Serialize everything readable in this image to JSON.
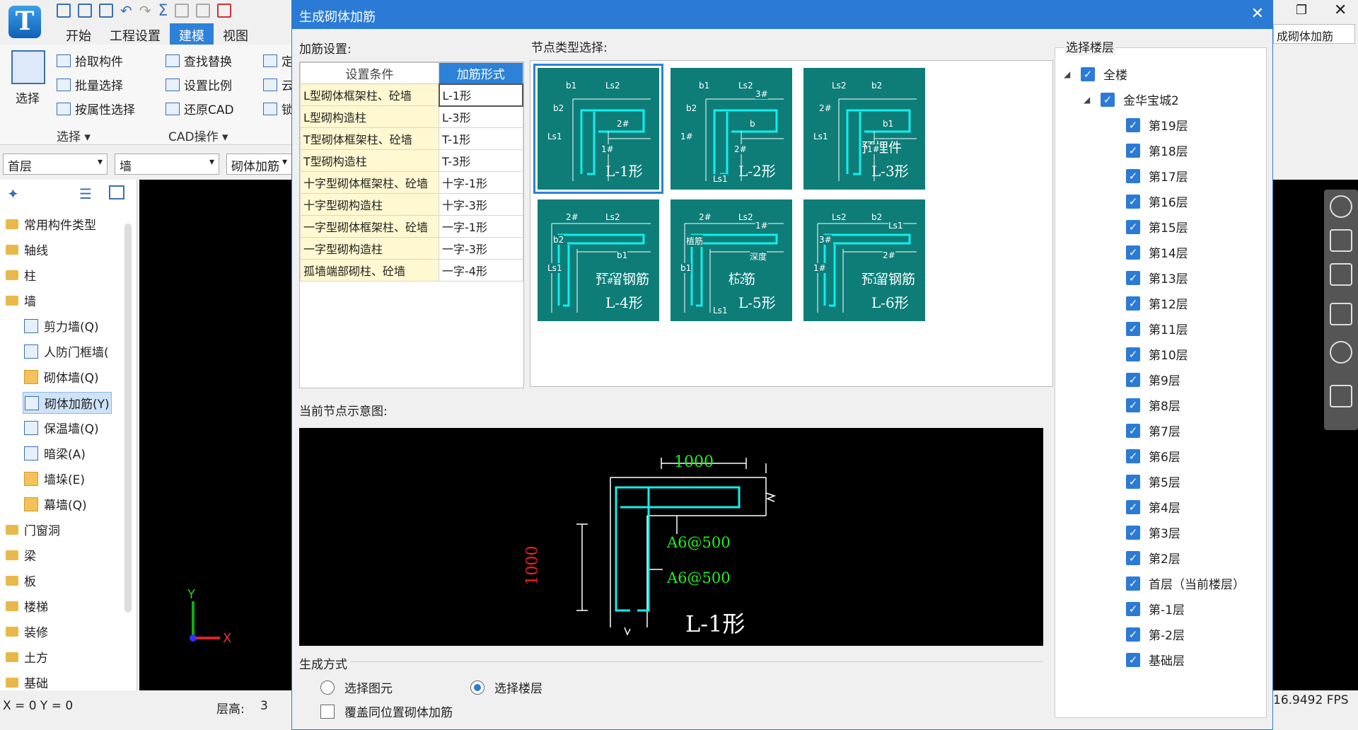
{
  "app": {
    "logo": "T"
  },
  "ribbon": {
    "tabs": [
      "开始",
      "工程设置",
      "建模",
      "视图"
    ],
    "active_tab": "建模",
    "select_label": "选择",
    "pick": "拾取构件",
    "batch": "批量选择",
    "by_attr": "按属性选择",
    "find_replace": "查找替换",
    "set_scale": "设置比例",
    "restore_cad": "还原CAD",
    "group_select": "选择",
    "group_cad": "CAD操作",
    "partial1": "定",
    "partial2": "云",
    "partial3": "锁"
  },
  "selectors": {
    "floor": "首层",
    "type": "墙",
    "component": "砌体加筋"
  },
  "tree": {
    "items": [
      "常用构件类型",
      "轴线",
      "柱",
      "墙"
    ],
    "wall_children": [
      "剪力墙(Q)",
      "人防门框墙(",
      "砌体墙(Q)",
      "砌体加筋(Y)",
      "保温墙(Q)",
      "暗梁(A)",
      "墙垛(E)",
      "幕墙(Q)"
    ],
    "items2": [
      "门窗洞",
      "梁",
      "板",
      "楼梯",
      "装修",
      "土方",
      "基础"
    ]
  },
  "canvas": {
    "axis_x": "X",
    "axis_y": "Y"
  },
  "status": {
    "coords": "X = 0 Y = 0",
    "floor_height_label": "层高:",
    "floor_height_value": "3",
    "fps": "16.9492 FPS"
  },
  "right": {
    "search_text": "成砌体加筋"
  },
  "dialog": {
    "title": "生成砌体加筋",
    "rebar_settings_label": "加筋设置:",
    "node_type_label": "节点类型选择:",
    "floor_select_label": "选择楼层",
    "current_node_label": "当前节点示意图:",
    "gen_method_label": "生成方式",
    "radio_select_element": "选择图元",
    "radio_select_floor": "选择楼层",
    "overwrite_label": "覆盖同位置砌体加筋",
    "table": {
      "headers": [
        "设置条件",
        "加筋形式"
      ],
      "rows": [
        [
          "L型砌体框架柱、砼墙",
          "L-1形"
        ],
        [
          "L型砌构造柱",
          "L-3形"
        ],
        [
          "T型砌体框架柱、砼墙",
          "T-1形"
        ],
        [
          "T型砌构造柱",
          "T-3形"
        ],
        [
          "十字型砌体框架柱、砼墙",
          "十字-1形"
        ],
        [
          "十字型砌构造柱",
          "十字-3形"
        ],
        [
          "一字型砌体框架柱、砼墙",
          "一字-1形"
        ],
        [
          "一字型砌构造柱",
          "一字-3形"
        ],
        [
          "孤墙端部砌柱、砼墙",
          "一字-4形"
        ]
      ]
    },
    "nodes": [
      {
        "name": "L-1形",
        "labels": [
          "b1",
          "Ls2",
          "b2",
          "2#",
          "1#",
          "Ls1"
        ]
      },
      {
        "name": "L-2形",
        "labels": [
          "b1",
          "Ls2",
          "b2",
          "b",
          "2#",
          "1#",
          "3#",
          "Ls1"
        ]
      },
      {
        "name": "L-3形",
        "extra": "预埋件",
        "labels": [
          "Ls2",
          "b2",
          "2#",
          "b1",
          "1#",
          "Ls1"
        ]
      },
      {
        "name": "L-4形",
        "extra": "预留钢筋",
        "labels": [
          "2#",
          "Ls2",
          "b2",
          "b1",
          "1#",
          "Ls1"
        ]
      },
      {
        "name": "L-5形",
        "extra": "植筋",
        "labels": [
          "2#",
          "Ls2",
          "植筋",
          "深度",
          "b2",
          "b1",
          "1#",
          "Ls1"
        ]
      },
      {
        "name": "L-6形",
        "extra": "预留钢筋",
        "labels": [
          "Ls2",
          "b2",
          "3#",
          "2#",
          "b1",
          "1#",
          "Ls1"
        ]
      }
    ],
    "preview": {
      "dim_top": "1000",
      "dim_left": "1000",
      "rebar1": "A6@500",
      "rebar2": "A6@500",
      "name": "L-1形"
    },
    "floors": {
      "all": "全楼",
      "project": "金华宝城2",
      "list": [
        "第19层",
        "第18层",
        "第17层",
        "第16层",
        "第15层",
        "第14层",
        "第13层",
        "第12层",
        "第11层",
        "第10层",
        "第9层",
        "第8层",
        "第7层",
        "第6层",
        "第5层",
        "第4层",
        "第3层",
        "第2层",
        "首层（当前楼层）",
        "第-1层",
        "第-2层",
        "基础层"
      ]
    }
  }
}
